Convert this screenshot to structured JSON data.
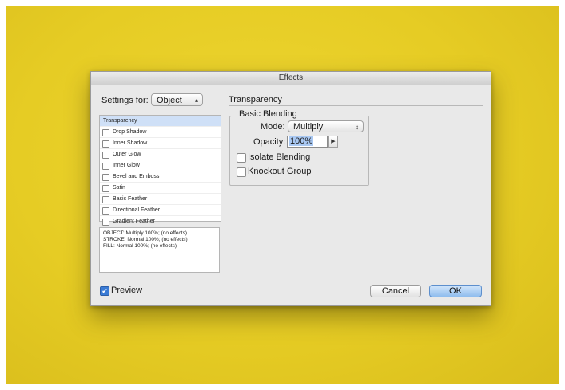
{
  "window": {
    "title": "Effects"
  },
  "settings": {
    "label": "Settings for:",
    "selected": "Object"
  },
  "effects_list": [
    {
      "label": "Transparency",
      "selected": true,
      "has_checkbox": false
    },
    {
      "label": "Drop Shadow",
      "selected": false,
      "has_checkbox": true
    },
    {
      "label": "Inner Shadow",
      "selected": false,
      "has_checkbox": true
    },
    {
      "label": "Outer Glow",
      "selected": false,
      "has_checkbox": true
    },
    {
      "label": "Inner Glow",
      "selected": false,
      "has_checkbox": true
    },
    {
      "label": "Bevel and Emboss",
      "selected": false,
      "has_checkbox": true
    },
    {
      "label": "Satin",
      "selected": false,
      "has_checkbox": true
    },
    {
      "label": "Basic Feather",
      "selected": false,
      "has_checkbox": true
    },
    {
      "label": "Directional Feather",
      "selected": false,
      "has_checkbox": true
    },
    {
      "label": "Gradient Feather",
      "selected": false,
      "has_checkbox": true
    }
  ],
  "summary": {
    "lines": [
      "OBJECT: Multiply 100%; (no effects)",
      "STROKE: Normal 100%; (no effects)",
      "FILL: Normal 100%; (no effects)"
    ]
  },
  "preview": {
    "label": "Preview",
    "checked": true
  },
  "panel": {
    "title": "Transparency",
    "group_title": "Basic Blending",
    "mode_label": "Mode:",
    "mode_value": "Multiply",
    "opacity_label": "Opacity:",
    "opacity_value": "100%",
    "isolate_label": "Isolate Blending",
    "knockout_label": "Knockout Group"
  },
  "buttons": {
    "cancel": "Cancel",
    "ok": "OK"
  },
  "colors": {
    "background": "#e6cc24",
    "accent": "#3a7bd5",
    "selection": "#cfe0f7"
  }
}
